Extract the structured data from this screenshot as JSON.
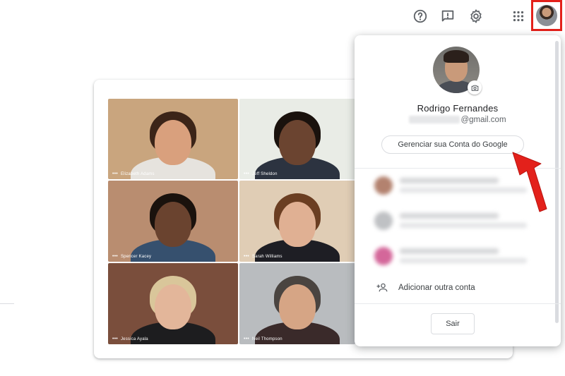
{
  "toolbar": {
    "help_icon": "help-circle-icon",
    "feedback_icon": "feedback-icon",
    "settings_icon": "gear-icon",
    "apps_icon": "apps-grid-icon",
    "account_icon": "account-avatar-icon"
  },
  "meeting": {
    "participants": [
      {
        "name": "Elizabeth Adams",
        "bg": "#c9a57e",
        "skin": "#d9a07d",
        "hair": "#3b2418",
        "shirt": "#e6e3de"
      },
      {
        "name": "Jeff Sheldon",
        "bg": "#e9ece6",
        "skin": "#6b4430",
        "hair": "#1a120d",
        "shirt": "#2c3340"
      },
      {
        "name": "Spencer Kacey",
        "bg": "#b98d70",
        "skin": "#6a432f",
        "hair": "#1a120d",
        "shirt": "#36506e"
      },
      {
        "name": "Sarah Williams",
        "bg": "#e0cdb5",
        "skin": "#e0b093",
        "hair": "#6b3e22",
        "shirt": "#1e1e24"
      },
      {
        "name": "Jessica Ayala",
        "bg": "#7a4e3c",
        "skin": "#e3b69a",
        "hair": "#d9c69a",
        "shirt": "#1d1d1f"
      },
      {
        "name": "Neil Thompson",
        "bg": "#b9bcbf",
        "skin": "#d6a585",
        "hair": "#4a4440",
        "shirt": "#3a2a2a"
      }
    ]
  },
  "account": {
    "name": "Rodrigo Fernandes",
    "email_suffix": "@gmail.com",
    "manage_label": "Gerenciar sua Conta do Google",
    "add_account_label": "Adicionar outra conta",
    "signout_label": "Sair",
    "other_account_colors": [
      "#b3826f",
      "#bfc1c4",
      "#d4679a"
    ]
  },
  "colors": {
    "highlight_red": "#e3211b",
    "arrow_red": "#e3211b"
  }
}
